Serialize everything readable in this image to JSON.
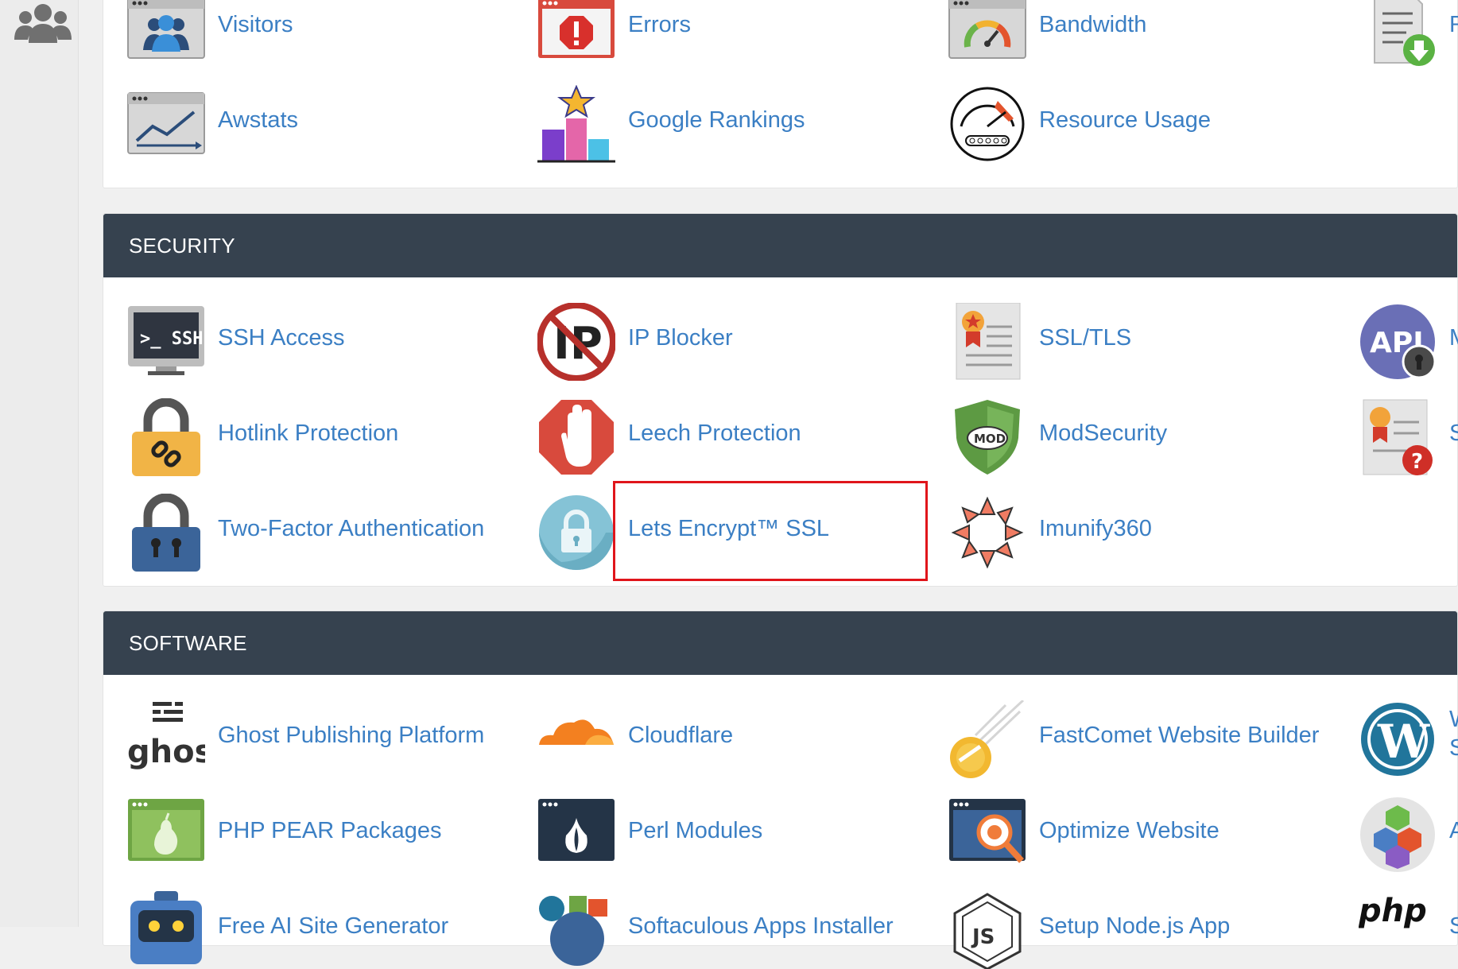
{
  "metrics": {
    "items": [
      {
        "label": "Visitors",
        "icon": "visitors-icon"
      },
      {
        "label": "Errors",
        "icon": "errors-icon"
      },
      {
        "label": "Bandwidth",
        "icon": "bandwidth-icon"
      },
      {
        "label": "Raw",
        "icon": "raw-access-icon"
      },
      {
        "label": "Awstats",
        "icon": "awstats-icon"
      },
      {
        "label": "Google Rankings",
        "icon": "google-rankings-icon"
      },
      {
        "label": "Resource Usage",
        "icon": "resource-usage-icon"
      }
    ]
  },
  "security": {
    "title": "SECURITY",
    "items": [
      {
        "label": "SSH Access",
        "icon": "ssh-icon"
      },
      {
        "label": "IP Blocker",
        "icon": "ip-blocker-icon"
      },
      {
        "label": "SSL/TLS",
        "icon": "ssl-certificate-icon"
      },
      {
        "label": "Mar",
        "icon": "api-lock-icon"
      },
      {
        "label": "Hotlink Protection",
        "icon": "hotlink-lock-icon"
      },
      {
        "label": "Leech Protection",
        "icon": "stop-hand-icon"
      },
      {
        "label": "ModSecurity",
        "icon": "mod-shield-icon"
      },
      {
        "label": "SSL/",
        "icon": "ssl-status-icon"
      },
      {
        "label": "Two-Factor Authentication",
        "icon": "padlock-icon"
      },
      {
        "label": "Lets Encrypt™ SSL",
        "icon": "lets-encrypt-lock-icon"
      },
      {
        "label": "Imunify360",
        "icon": "imunify-icon"
      }
    ]
  },
  "software": {
    "title": "SOFTWARE",
    "items": [
      {
        "label": "Ghost Publishing Platform",
        "icon": "ghost-icon"
      },
      {
        "label": "Cloudflare",
        "icon": "cloudflare-icon"
      },
      {
        "label": "FastComet Website Builder",
        "icon": "fastcomet-icon"
      },
      {
        "label": "Wor",
        "label2": "Soft",
        "icon": "wordpress-icon"
      },
      {
        "label": "PHP PEAR Packages",
        "icon": "php-pear-icon"
      },
      {
        "label": "Perl Modules",
        "icon": "perl-onion-icon"
      },
      {
        "label": "Optimize Website",
        "icon": "optimize-gear-icon"
      },
      {
        "label": "App",
        "icon": "app-cubes-icon"
      },
      {
        "label": "Free AI Site Generator",
        "icon": "ai-robot-icon"
      },
      {
        "label": "Softaculous Apps Installer",
        "icon": "softaculous-icon"
      },
      {
        "label": "Setup Node.js App",
        "icon": "nodejs-icon"
      },
      {
        "label": "Sele",
        "icon": "php-logo-icon",
        "logo_text": "php"
      }
    ]
  },
  "colors": {
    "link": "#3b7fc4",
    "header_bg": "#36424f",
    "highlight": "#e0151b"
  }
}
